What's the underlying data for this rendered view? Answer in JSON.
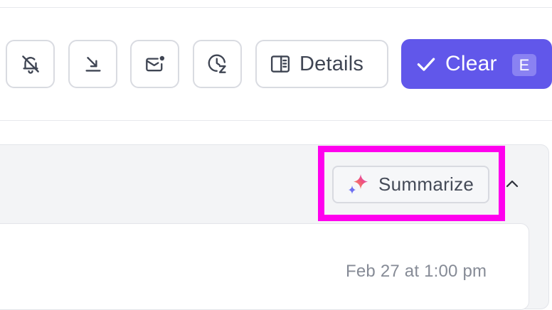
{
  "toolbar": {
    "icon_buttons": [
      {
        "icon": "bell-off-icon"
      },
      {
        "icon": "move-down-icon"
      },
      {
        "icon": "mark-unread-icon"
      },
      {
        "icon": "snooze-icon"
      }
    ],
    "details_label": "Details",
    "clear_label": "Clear",
    "clear_shortcut": "E"
  },
  "thread": {
    "summarize_label": "Summarize",
    "collapse_icon": "chevron-up-icon",
    "message": {
      "timestamp": "Feb 27 at 1:00 pm"
    }
  },
  "colors": {
    "accent": "#6157ea",
    "highlight": "#ff00ee"
  }
}
